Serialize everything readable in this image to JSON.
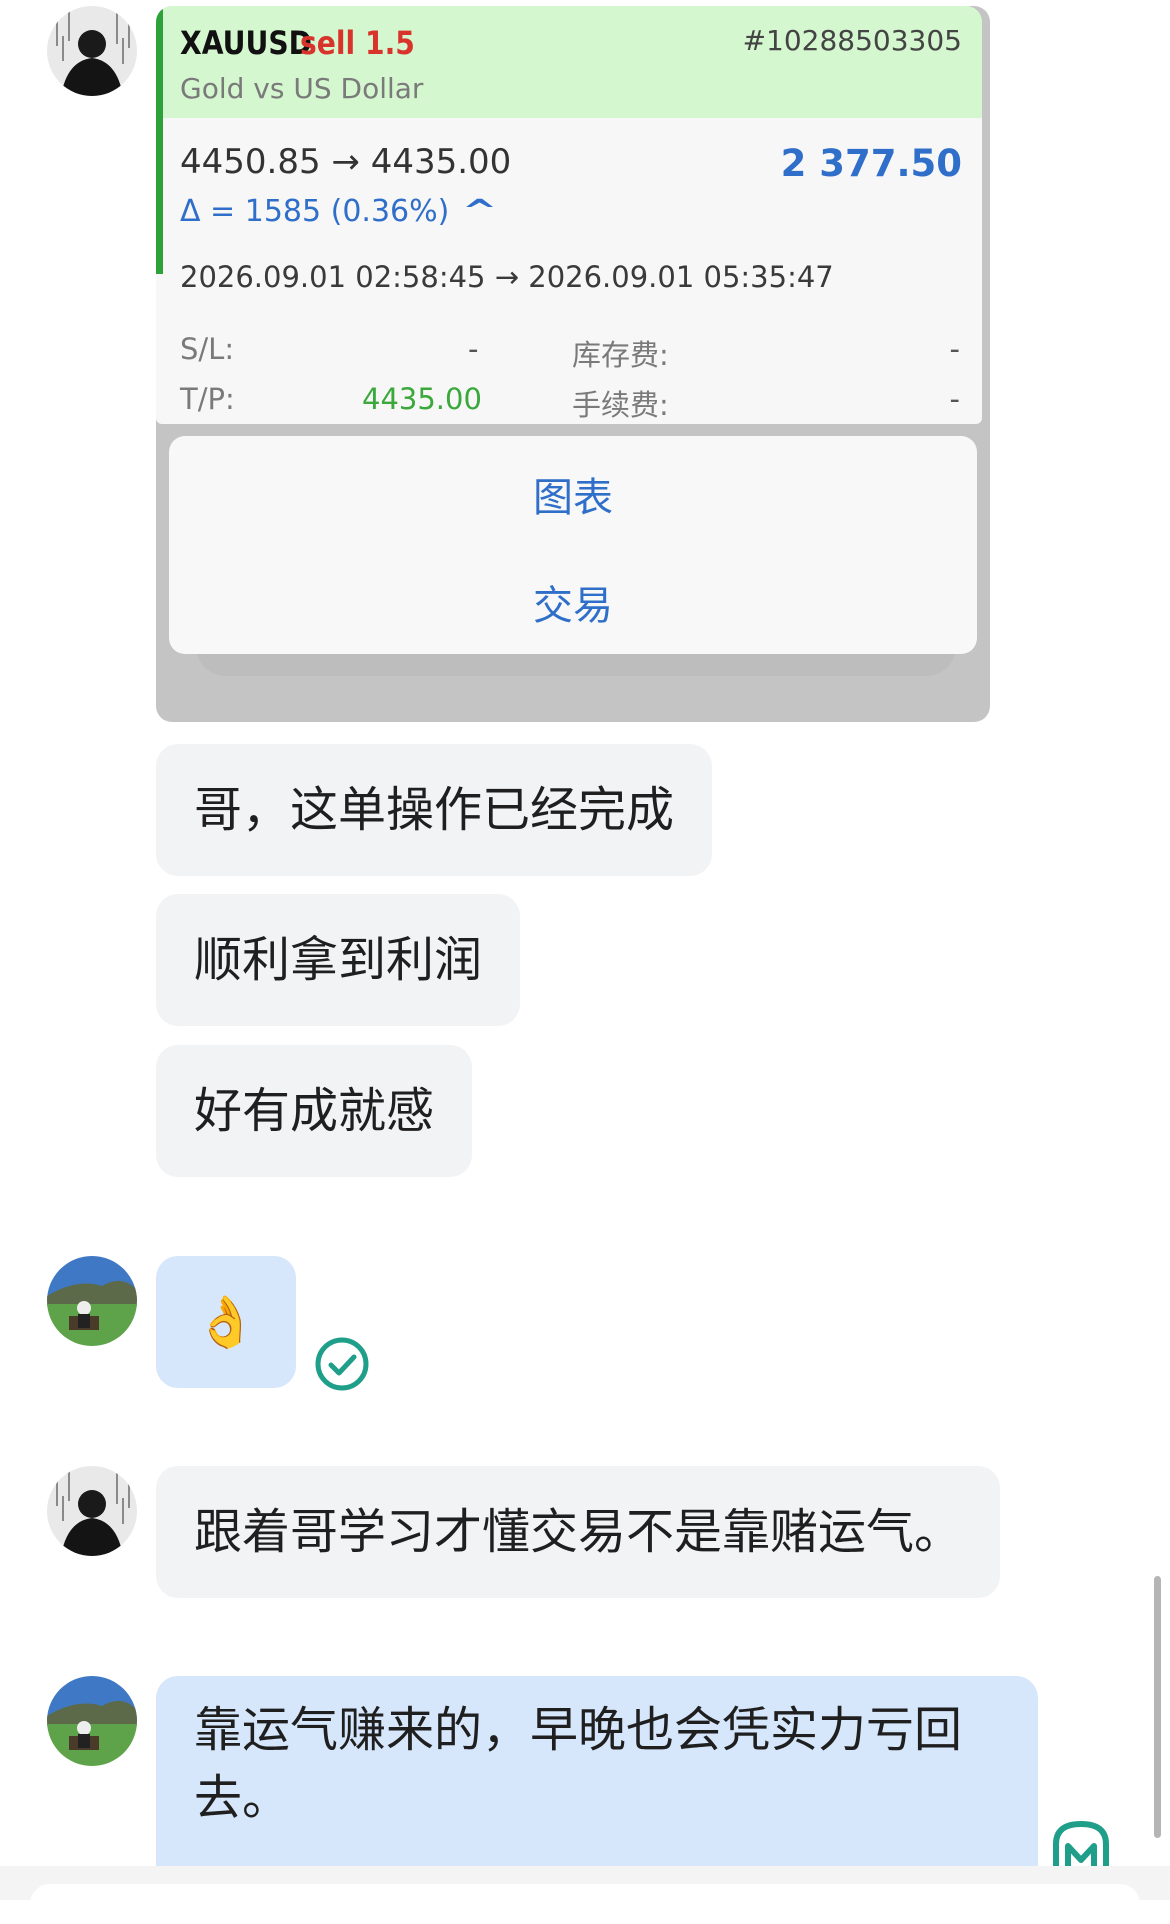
{
  "trade": {
    "symbol": "XAUUSD",
    "side_volume": "sell 1.5",
    "order_id": "#10288503305",
    "description": "Gold vs US Dollar",
    "prices": "4450.85 → 4435.00",
    "profit": "2 377.50",
    "delta": "Δ = 1585 (0.36%)",
    "delta_arrow": "^",
    "times": "2026.09.01 02:58:45 → 2026.09.01 05:35:47",
    "sl_label": "S/L:",
    "sl_value": "-",
    "swap_label": "库存费:",
    "swap_value": "-",
    "tp_label": "T/P:",
    "tp_value": "4435.00",
    "fee_label": "手续费:",
    "fee_value": "-"
  },
  "popup_menu": {
    "item_chart": "图表",
    "item_trade": "交易"
  },
  "messages": [
    {
      "text": "哥，这单操作已经完成"
    },
    {
      "text": "顺利拿到利润"
    },
    {
      "text": "好有成就感"
    },
    {
      "text": "👌"
    },
    {
      "text": "跟着哥学习才懂交易不是靠赌运气。"
    },
    {
      "text": "靠运气赚来的，早晚也会凭实力亏回"
    },
    {
      "text": "去。"
    }
  ],
  "icons": {
    "read_receipt": "check-circle-icon",
    "watermark": "watermark-logo-icon"
  },
  "colors": {
    "accent_green": "#2ea23a",
    "sell_red": "#d9342b",
    "profit_blue": "#2f6fc9",
    "tp_green": "#3aa83a",
    "bubble_gray": "#f2f3f5",
    "bubble_blue": "#d6e6fb",
    "read_check": "#1f9e8a"
  }
}
